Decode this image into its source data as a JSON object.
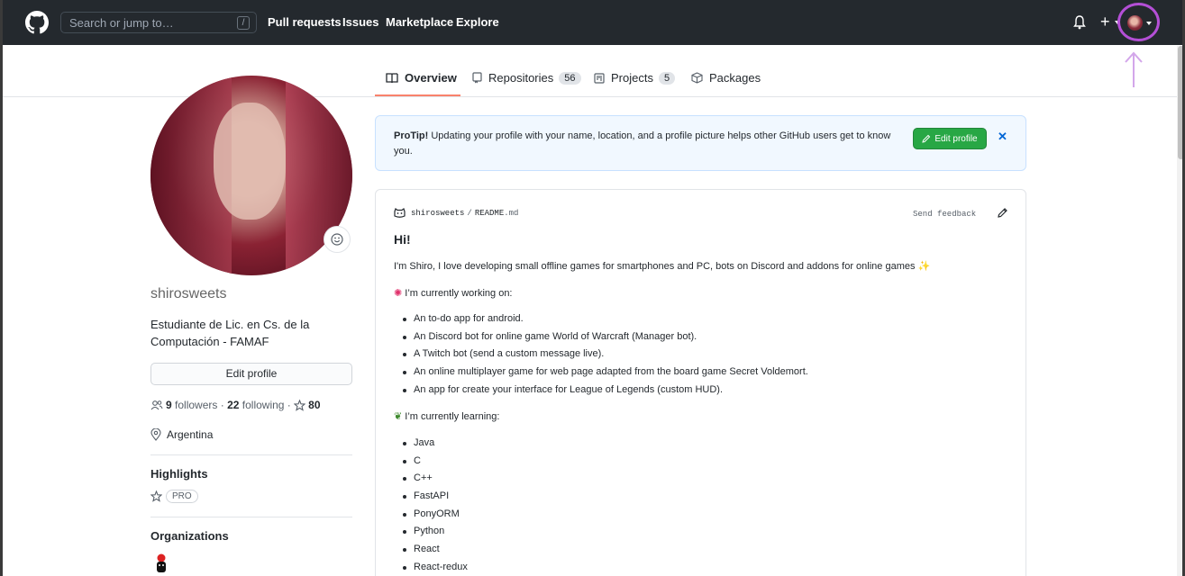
{
  "header": {
    "search_placeholder": "Search or jump to…",
    "search_shortcut": "/",
    "nav": [
      "Pull requests",
      "Issues",
      "Marketplace",
      "Explore"
    ]
  },
  "tabs": [
    {
      "label": "Overview",
      "count": ""
    },
    {
      "label": "Repositories",
      "count": "56"
    },
    {
      "label": "Projects",
      "count": "5"
    },
    {
      "label": "Packages",
      "count": ""
    }
  ],
  "profile": {
    "username": "shirosweets",
    "bio": "Estudiante de Lic. en Cs. de la Computación - FAMAF",
    "edit_label": "Edit profile",
    "followers_count": "9",
    "followers_label": "followers",
    "following_count": "22",
    "following_label": "following",
    "stars_count": "80",
    "location": "Argentina",
    "highlights_heading": "Highlights",
    "pro_badge": "PRO",
    "orgs_heading": "Organizations"
  },
  "protip": {
    "title": "ProTip!",
    "text": "Updating your profile with your name, location, and a profile picture helps other GitHub users get to know you.",
    "button": "Edit profile"
  },
  "readme": {
    "owner": "shirosweets",
    "file": "README",
    "ext": ".md",
    "feedback": "Send feedback",
    "heading": "Hi!",
    "intro": "I'm Shiro, I love developing small offline games for smartphones and PC, bots on Discord and addons for online games",
    "working_heading": "I’m currently working on:",
    "working": [
      "An to-do app for android.",
      "An Discord bot for online game World of Warcraft (Manager bot).",
      "A Twitch bot (send a custom message live).",
      "An online multiplayer game for web page adapted from the board game Secret Voldemort.",
      "An app for create your interface for League of Legends (custom HUD)."
    ],
    "learning_heading": "I’m currently learning:",
    "learning": [
      "Java",
      "C",
      "C++",
      "FastAPI",
      "PonyORM",
      "Python",
      "React",
      "React-redux"
    ]
  },
  "colors": {
    "header_bg": "#24292e",
    "accent_green": "#28a745",
    "link_blue": "#0366d6",
    "annotation_purple": "#b44fd6"
  }
}
